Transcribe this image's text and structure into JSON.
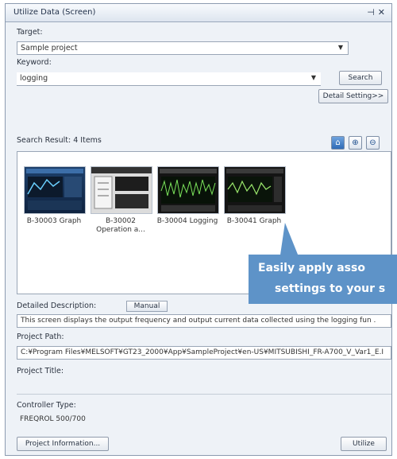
{
  "window": {
    "title": "Utilize Data (Screen)",
    "pin_icon": "pin-icon",
    "close_icon": "close-icon"
  },
  "target": {
    "label": "Target:",
    "value": "Sample project"
  },
  "keyword": {
    "label": "Keyword:",
    "value": "logging"
  },
  "buttons": {
    "search": "Search",
    "detail_settings": "Detail Setting>>",
    "manual": "Manual",
    "project_info": "Project Information...",
    "utilize": "Utilize"
  },
  "results": {
    "count_label": "Search Result: 4 Items",
    "items": [
      {
        "label": "B-30003 Graph"
      },
      {
        "label": "B-30002\nOperation a..."
      },
      {
        "label": "B-30004 Logging"
      },
      {
        "label": "B-30041 Graph"
      }
    ]
  },
  "callout": {
    "line1": "Easily apply asso",
    "line2": "settings to your s"
  },
  "description": {
    "label": "Detailed Description:",
    "text": "This screen displays the output frequency and output current data collected using the logging fun ."
  },
  "project_path": {
    "label": "Project Path:",
    "value": "C:¥Program Files¥MELSOFT¥GT23_2000¥App¥SampleProject¥en-US¥MITSUBISHI_FR-A700_V_Var1_E.I"
  },
  "project_title": {
    "label": "Project Title:",
    "value": ""
  },
  "controller": {
    "label": "Controller Type:",
    "value": "FREQROL 500/700"
  },
  "colors": {
    "accent": "#2f6bb6",
    "callout": "#5e93c8"
  }
}
